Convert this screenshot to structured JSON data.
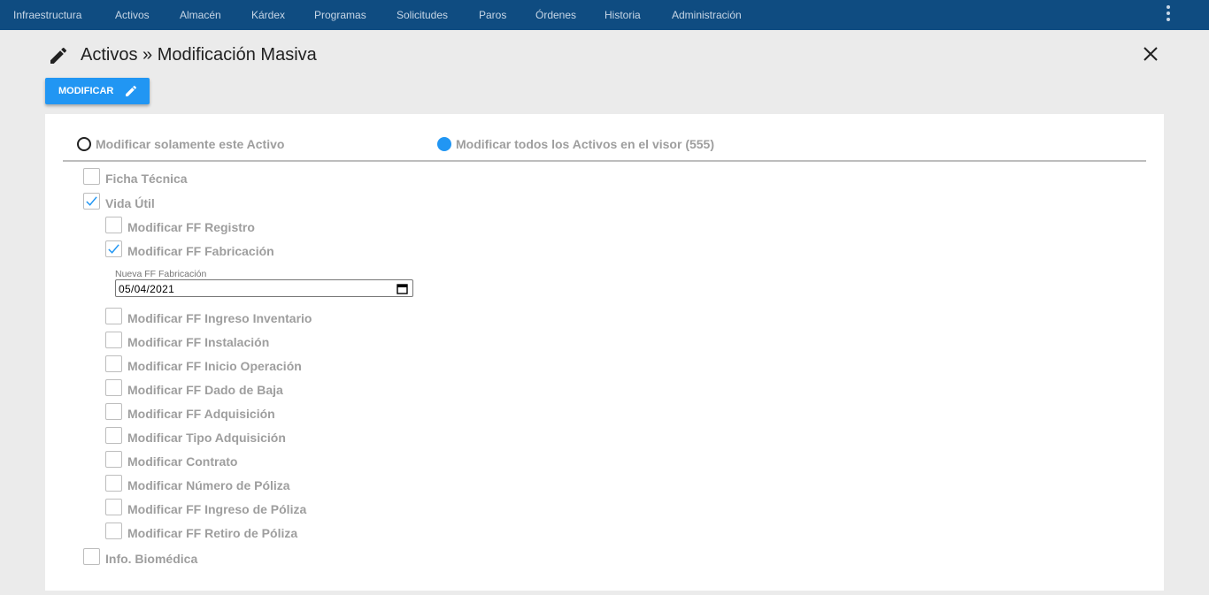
{
  "nav": {
    "items": [
      "Infraestructura",
      "Activos",
      "Almacén",
      "Kárdex",
      "Programas",
      "Solicitudes",
      "Paros",
      "Órdenes",
      "Historia",
      "Administración"
    ]
  },
  "header": {
    "title": "Activos » Modificación Masiva"
  },
  "toolbar": {
    "modify_label": "MODIFICAR"
  },
  "scope": {
    "option_single": "Modificar solamente este Activo",
    "option_all": "Modificar todos los Activos en el visor (555)",
    "selected": "all"
  },
  "sections": {
    "ficha_tecnica": {
      "label": "Ficha Técnica",
      "checked": false
    },
    "vida_util": {
      "label": "Vida Útil",
      "checked": true
    },
    "info_biomedica": {
      "label": "Info. Biomédica",
      "checked": false
    }
  },
  "vida_util_items": [
    {
      "label": "Modificar FF Registro",
      "checked": false
    },
    {
      "label": "Modificar FF Fabricación",
      "checked": true
    },
    {
      "label": "Modificar FF Ingreso Inventario",
      "checked": false
    },
    {
      "label": "Modificar FF Instalación",
      "checked": false
    },
    {
      "label": "Modificar FF Inicio Operación",
      "checked": false
    },
    {
      "label": "Modificar FF Dado de Baja",
      "checked": false
    },
    {
      "label": "Modificar FF Adquisición",
      "checked": false
    },
    {
      "label": "Modificar Tipo Adquisición",
      "checked": false
    },
    {
      "label": "Modificar Contrato",
      "checked": false
    },
    {
      "label": "Modificar Número de Póliza",
      "checked": false
    },
    {
      "label": "Modificar FF Ingreso de Póliza",
      "checked": false
    },
    {
      "label": "Modificar FF Retiro de Póliza",
      "checked": false
    }
  ],
  "fabricacion_field": {
    "label": "Nueva FF Fabricación",
    "value": "05/04/2021"
  },
  "colors": {
    "nav_bg": "#0f4c81",
    "accent": "#2196f3",
    "page_bg": "#ebebeb"
  }
}
